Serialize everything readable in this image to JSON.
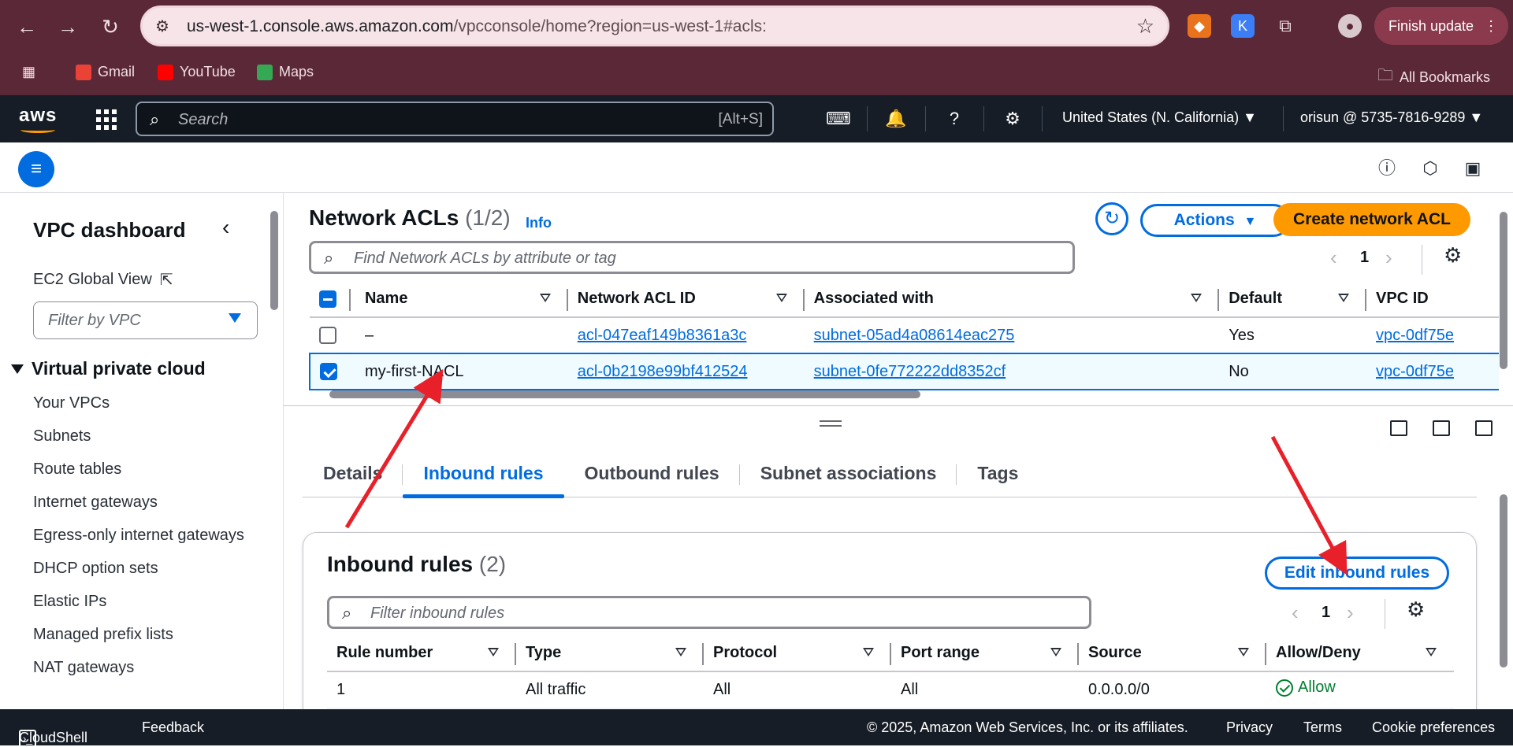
{
  "browser": {
    "url_host": "us-west-1.console.aws.amazon.com",
    "url_path": "/vpcconsole/home?region=us-west-1#acls:",
    "finish_update": "Finish update",
    "bookmarks": [
      "Gmail",
      "YouTube",
      "Maps"
    ],
    "all_bookmarks": "All Bookmarks"
  },
  "aws": {
    "logo": "aws",
    "search_placeholder": "Search",
    "search_shortcut": "[Alt+S]",
    "region": "United States (N. California) ▼",
    "account": "orisun @ 5735-7816-9289 ▼"
  },
  "sidebar": {
    "title": "VPC dashboard",
    "ec2_global": "EC2 Global View",
    "filter_placeholder": "Filter by VPC",
    "section": "Virtual private cloud",
    "items": [
      "Your VPCs",
      "Subnets",
      "Route tables",
      "Internet gateways",
      "Egress-only internet gateways",
      "DHCP option sets",
      "Elastic IPs",
      "Managed prefix lists",
      "NAT gateways"
    ]
  },
  "acl": {
    "title": "Network ACLs",
    "count": "(1/2)",
    "info": "Info",
    "actions": "Actions",
    "create": "Create network ACL",
    "search_placeholder": "Find Network ACLs by attribute or tag",
    "page": "1",
    "columns": [
      "Name",
      "Network ACL ID",
      "Associated with",
      "Default",
      "VPC ID"
    ],
    "rows": [
      {
        "name": "–",
        "id": "acl-047eaf149b8361a3c",
        "assoc": "subnet-05ad4a08614eac275",
        "default": "Yes",
        "vpc": "vpc-0df75e",
        "selected": false
      },
      {
        "name": "my-first-NACL",
        "id": "acl-0b2198e99bf412524",
        "assoc": "subnet-0fe772222dd8352cf",
        "default": "No",
        "vpc": "vpc-0df75e",
        "selected": true
      }
    ]
  },
  "detail": {
    "tabs": [
      "Details",
      "Inbound rules",
      "Outbound rules",
      "Subnet associations",
      "Tags"
    ],
    "active_tab": "Inbound rules",
    "card_title": "Inbound rules",
    "card_count": "(2)",
    "edit_button": "Edit inbound rules",
    "filter_placeholder": "Filter inbound rules",
    "page": "1",
    "columns": [
      "Rule number",
      "Type",
      "Protocol",
      "Port range",
      "Source",
      "Allow/Deny"
    ],
    "rows": [
      {
        "rule": "1",
        "type": "All traffic",
        "protocol": "All",
        "port": "All",
        "source": "0.0.0.0/0",
        "action": "Allow"
      }
    ]
  },
  "footer": {
    "cloudshell": "CloudShell",
    "feedback": "Feedback",
    "copyright": "© 2025, Amazon Web Services, Inc. or its affiliates.",
    "privacy": "Privacy",
    "terms": "Terms",
    "cookies": "Cookie preferences"
  },
  "colors": {
    "accent": "#006ce0",
    "primary_button": "#ff9900",
    "nav_bg": "#161d26",
    "browser_bg": "#5b2838",
    "annotation": "#e8202a"
  }
}
